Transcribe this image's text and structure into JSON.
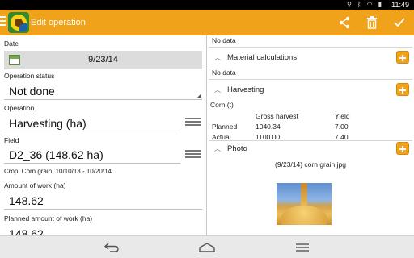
{
  "status_bar": {
    "time": "11:49"
  },
  "action_bar": {
    "title": "Edit operation"
  },
  "form": {
    "date_label": "Date",
    "date_value": "9/23/14",
    "status_label": "Operation status",
    "status_value": "Not done",
    "operation_label": "Operation",
    "operation_value": "Harvesting (ha)",
    "field_label": "Field",
    "field_value": "D2_36 (148,62 ha)",
    "crop_text": "Crop:  Corn grain, 10/10/13 - 10/20/14",
    "work_amount_label": "Amount of work (ha)",
    "work_amount_value": "148.62",
    "planned_work_label": "Planned amount of work (ha)",
    "planned_work_value": "148.62"
  },
  "details": {
    "top_no_data": "No data",
    "material": {
      "title": "Material calculations",
      "no_data": "No data"
    },
    "harvesting": {
      "title": "Harvesting",
      "crop_line": "Corn (t)",
      "columns": [
        "",
        "Gross harvest",
        "Yield"
      ],
      "rows": [
        [
          "Planned",
          "1040.34",
          "7.00"
        ],
        [
          "Actual",
          "1100.00",
          "7.40"
        ]
      ]
    },
    "photo": {
      "title": "Photo",
      "caption": "(9/23/14) corn grain.jpg"
    }
  },
  "icons": {
    "share": "share-icon",
    "delete": "trash-icon",
    "confirm": "check-icon",
    "add": "plus-icon",
    "list": "list-icon",
    "calendar": "calendar-icon"
  },
  "colors": {
    "accent": "#f0a21a",
    "nav_bg": "#e9e9e9"
  }
}
